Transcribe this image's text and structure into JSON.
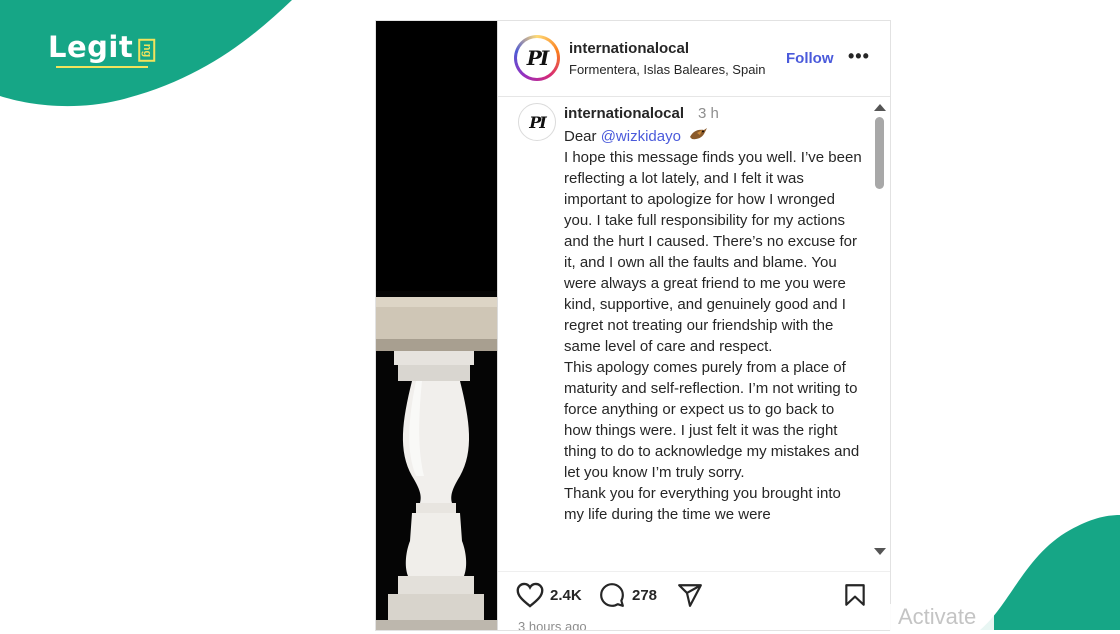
{
  "brand": {
    "name": "Legit",
    "suffix": "ng",
    "color": "#16a686",
    "accent": "#f2e35c"
  },
  "post": {
    "username": "internationalocal",
    "location": "Formentera, Islas Baleares, Spain",
    "follow_label": "Follow",
    "more_label": "•••",
    "avatar_text": "PI",
    "comment": {
      "username": "internationalocal",
      "time": "3 h",
      "greeting_prefix": "Dear ",
      "mention": "@wizkidayo",
      "lines": [
        "I hope this message finds you well. I’ve been reflecting a lot lately, and I felt it was important to apologize for how I wronged you. I take full responsibility for my actions and the hurt I caused. There’s no excuse for it, and I own all the faults and blame. You were always a great friend to me you were kind, supportive, and genuinely good and I regret not treating our friendship with the same level of care and respect.",
        "This apology comes purely from a place of maturity and self-reflection. I’m not writing to force anything or expect us to go back to how things were. I just felt it was the right thing to do to acknowledge my mistakes and let you know I’m truly sorry.",
        "Thank you for everything you brought into my life during the time we were"
      ]
    },
    "actions": {
      "likes": "2.4K",
      "comments": "278"
    },
    "timestamp": "3 hours ago"
  },
  "overlay": {
    "activate_text": "Activate"
  },
  "icons": [
    "heart-icon",
    "comment-icon",
    "share-icon",
    "bookmark-icon",
    "more-icon"
  ]
}
